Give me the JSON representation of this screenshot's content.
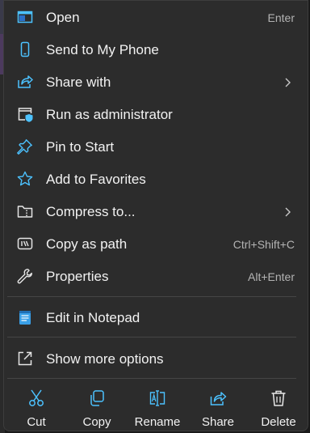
{
  "menu": {
    "items": [
      {
        "label": "Open",
        "shortcut": "Enter",
        "icon": "window-icon"
      },
      {
        "label": "Send to My Phone",
        "icon": "phone-icon"
      },
      {
        "label": "Share with",
        "icon": "share-icon",
        "submenu": true
      },
      {
        "label": "Run as administrator",
        "icon": "shield-window-icon"
      },
      {
        "label": "Pin to Start",
        "icon": "pin-icon"
      },
      {
        "label": "Add to Favorites",
        "icon": "star-icon"
      },
      {
        "label": "Compress to...",
        "icon": "zip-folder-icon",
        "submenu": true
      },
      {
        "label": "Copy as path",
        "shortcut": "Ctrl+Shift+C",
        "icon": "copy-path-icon"
      },
      {
        "label": "Properties",
        "shortcut": "Alt+Enter",
        "icon": "wrench-icon"
      },
      {
        "label": "Edit in Notepad",
        "icon": "notepad-icon"
      },
      {
        "label": "Show more options",
        "icon": "open-external-icon"
      }
    ],
    "actions": [
      {
        "label": "Cut",
        "icon": "scissors-icon"
      },
      {
        "label": "Copy",
        "icon": "copy-icon"
      },
      {
        "label": "Rename",
        "icon": "rename-icon"
      },
      {
        "label": "Share",
        "icon": "share-icon"
      },
      {
        "label": "Delete",
        "icon": "trash-icon"
      }
    ]
  },
  "colors": {
    "background": "#2c2c2c",
    "text": "#f2f2f2",
    "shortcut_text": "#b3b3b3",
    "accent": "#4cc2ff",
    "separator": "#454545"
  }
}
